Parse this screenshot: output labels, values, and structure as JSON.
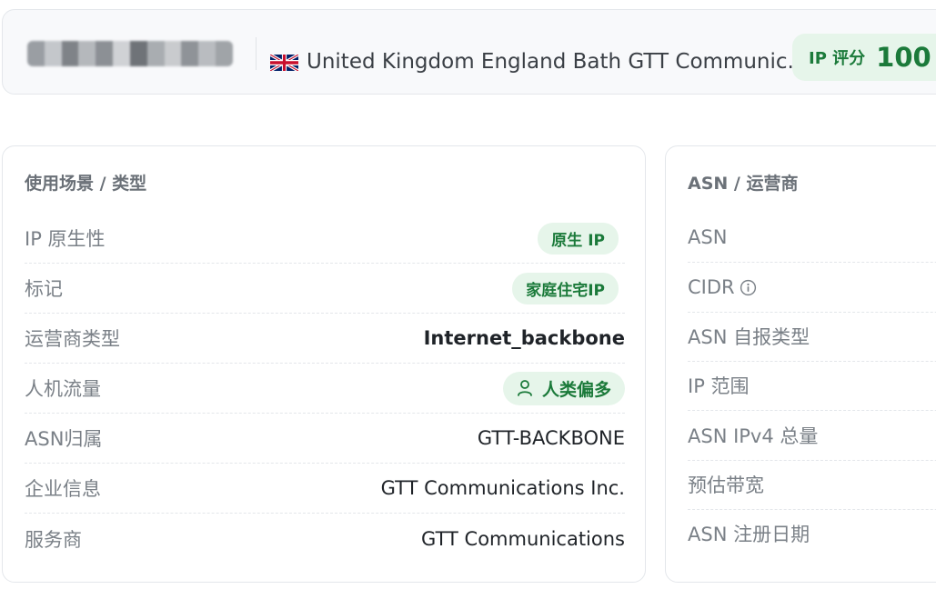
{
  "header": {
    "location": "United Kingdom England Bath GTT Communic...",
    "score_label": "IP 评分",
    "score_value": "100",
    "flag_icon": "uk-flag-icon"
  },
  "usage_card": {
    "title": "使用场景 / 类型",
    "rows": [
      {
        "label": "IP 原生性",
        "value": "原生 IP",
        "kind": "badge"
      },
      {
        "label": "标记",
        "value": "家庭住宅IP",
        "kind": "badge"
      },
      {
        "label": "运营商类型",
        "value": "Internet_backbone",
        "kind": "bold"
      },
      {
        "label": "人机流量",
        "value": "人类偏多",
        "kind": "badge-icon",
        "icon": "person-icon"
      },
      {
        "label": "ASN归属",
        "value": "GTT-BACKBONE",
        "kind": "text"
      },
      {
        "label": "企业信息",
        "value": "GTT Communications Inc.",
        "kind": "text"
      },
      {
        "label": "服务商",
        "value": "GTT Communications",
        "kind": "text"
      }
    ]
  },
  "asn_card": {
    "title": "ASN / 运营商",
    "rows": [
      {
        "label": "ASN"
      },
      {
        "label": "CIDR",
        "icon": "info-icon"
      },
      {
        "label": "ASN 自报类型"
      },
      {
        "label": "IP 范围"
      },
      {
        "label": "ASN IPv4 总量"
      },
      {
        "label": "预估带宽"
      },
      {
        "label": "ASN 注册日期"
      }
    ]
  },
  "colors": {
    "accent_green": "#1b7a3a",
    "badge_bg": "#e6f5ea",
    "label_gray": "#7a8087"
  }
}
